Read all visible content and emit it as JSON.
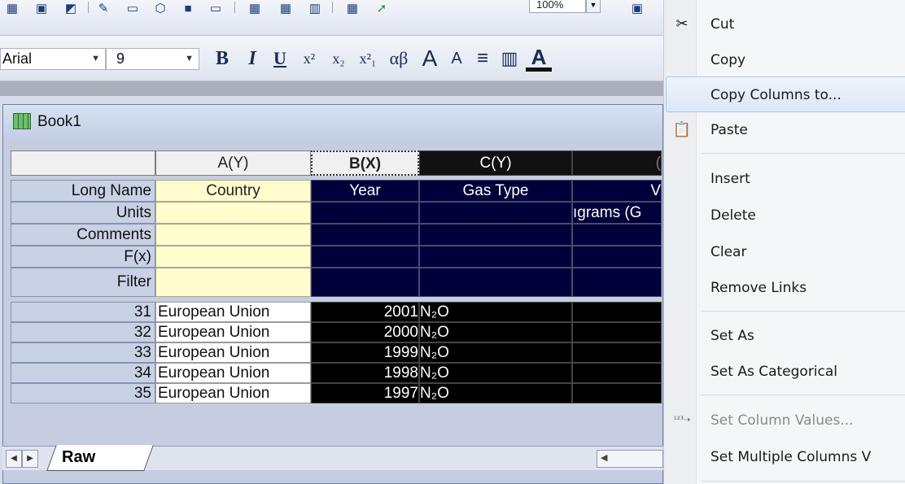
{
  "toolbar": {
    "zoom": "100%",
    "font_name": "Arial",
    "font_size": "9",
    "format_buttons": [
      "B",
      "I",
      "U",
      "x²",
      "x₂",
      "x²₁",
      "αβ",
      "A",
      "A",
      "≡",
      "▥",
      "A"
    ]
  },
  "workbook": {
    "title": "Book1",
    "columns": [
      {
        "letter": "",
        "header": ""
      },
      {
        "header": "A(Y)"
      },
      {
        "header": "B(X)"
      },
      {
        "header": "C(Y)"
      },
      {
        "header": "("
      }
    ],
    "label_rows": [
      {
        "label": "Long Name",
        "a": "Country",
        "b": "Year",
        "c": "Gas Type",
        "d": "V"
      },
      {
        "label": "Units",
        "a": "",
        "b": "",
        "c": "",
        "d": "ıgrams (G"
      },
      {
        "label": "Comments",
        "a": "",
        "b": "",
        "c": "",
        "d": ""
      },
      {
        "label": "F(x)",
        "a": "",
        "b": "",
        "c": "",
        "d": ""
      },
      {
        "label": "Filter",
        "a": "",
        "b": "",
        "c": "",
        "d": ""
      }
    ],
    "data_rows": [
      {
        "row": "31",
        "a": "European Union",
        "b": "2001",
        "c": "N₂O"
      },
      {
        "row": "32",
        "a": "European Union",
        "b": "2000",
        "c": "N₂O"
      },
      {
        "row": "33",
        "a": "European Union",
        "b": "1999",
        "c": "N₂O"
      },
      {
        "row": "34",
        "a": "European Union",
        "b": "1998",
        "c": "N₂O"
      },
      {
        "row": "35",
        "a": "European Union",
        "b": "1997",
        "c": "N₂O"
      }
    ],
    "sheet_tab": "Raw"
  },
  "context_menu": {
    "items": [
      {
        "label": "Cut",
        "icon": "scissors-icon"
      },
      {
        "label": "Copy"
      },
      {
        "label": "Copy Columns to..."
      },
      {
        "label": "Paste",
        "icon": "clipboard-icon"
      },
      {
        "label": "Insert"
      },
      {
        "label": "Delete"
      },
      {
        "label": "Clear"
      },
      {
        "label": "Remove Links"
      },
      {
        "label": "Set As"
      },
      {
        "label": "Set As Categorical"
      },
      {
        "label": "Set Column Values...",
        "icon": "set-values-icon"
      },
      {
        "label": "Set Multiple Columns V"
      }
    ]
  },
  "colors": {
    "selection": "#00003a",
    "long_name_row": "#fffcce",
    "menu_highlight": "#dbe8f7"
  }
}
